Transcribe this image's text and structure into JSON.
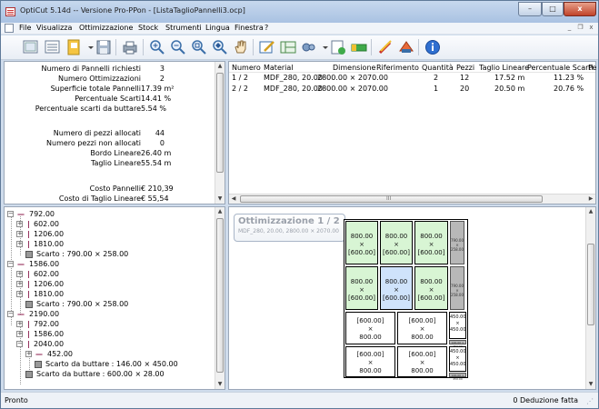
{
  "window": {
    "title": "OptiCut 5.14d -- Versione Pro-PPon - [ListaTaglioPannelli3.ocp]",
    "minimize_glyph": "–",
    "maximize_glyph": "□",
    "close_glyph": "x",
    "mdi_minimize_glyph": "_",
    "mdi_restore_glyph": "❐",
    "mdi_close_glyph": "x"
  },
  "menu": [
    "File",
    "Visualizza",
    "Ottimizzazione",
    "Stock",
    "Strumenti",
    "Lingua",
    "Finestra",
    "?"
  ],
  "toolbar": {
    "icons": [
      "table-icon",
      "list-icon",
      "new-document-icon",
      "save-icon",
      "print-icon",
      "zoom-in-icon",
      "zoom-out-icon",
      "zoom-fit-icon",
      "zoom-selection-icon",
      "hand-pan-icon",
      "edit-icon",
      "optimize-icon",
      "settings-icon",
      "export-icon",
      "database-icon",
      "pencil-icon",
      "materials-icon",
      "info-icon"
    ]
  },
  "summary": [
    {
      "label": "Numero di Pannelli richiesti",
      "value": "3"
    },
    {
      "label": "Numero Ottimizzazioni",
      "value": "2"
    },
    {
      "label": "Superficie totale Pannelli",
      "value": "17.39 m²"
    },
    {
      "label": "Percentuale Scarti",
      "value": "14.41 %"
    },
    {
      "label": "Percentuale scarti da buttare",
      "value": "5.54 %"
    },
    {
      "label": "",
      "value": ""
    },
    {
      "label": "Numero di pezzi allocati",
      "value": "44"
    },
    {
      "label": "Numero pezzi non allocati",
      "value": "0"
    },
    {
      "label": "Bordo Lineare",
      "value": "26.40 m"
    },
    {
      "label": "Taglio Lineare",
      "value": "55.54 m"
    },
    {
      "label": "",
      "value": ""
    },
    {
      "label": "Costo Pannelli",
      "value": "€ 210,39"
    },
    {
      "label": "Costo di Taglio Lineare",
      "value": "€ 55,54"
    }
  ],
  "grid": {
    "columns": [
      "Numero",
      "Material",
      "Dimensione",
      "Riferimento",
      "Quantità",
      "Pezzi",
      "Taglio Lineare",
      "Percentuale Scarti",
      "Pe"
    ],
    "rows": [
      {
        "numero": "1 / 2",
        "material": "MDF_280, 20.00",
        "dimensione": "2800.00 × 2070.00",
        "riferimento": "",
        "quantita": "2",
        "pezzi": "12",
        "taglio": "17.52 m",
        "scarti": "11.23 %"
      },
      {
        "numero": "2 / 2",
        "material": "MDF_280, 20.00",
        "dimensione": "2800.00 × 2070.00",
        "riferimento": "",
        "quantita": "1",
        "pezzi": "20",
        "taglio": "20.50 m",
        "scarti": "20.76 %"
      }
    ],
    "hscroll_mark": "III"
  },
  "tree": {
    "nodes": [
      {
        "label": "792.00",
        "level": 0,
        "kind": "strip"
      },
      {
        "label": "602.00",
        "level": 1,
        "kind": "cut"
      },
      {
        "label": "1206.00",
        "level": 1,
        "kind": "cut"
      },
      {
        "label": "1810.00",
        "level": 1,
        "kind": "cut"
      },
      {
        "label": "Scarto : 790.00 × 258.00",
        "level": 1,
        "kind": "scrap"
      },
      {
        "label": "1586.00",
        "level": 0,
        "kind": "strip"
      },
      {
        "label": "602.00",
        "level": 1,
        "kind": "cut"
      },
      {
        "label": "1206.00",
        "level": 1,
        "kind": "cut"
      },
      {
        "label": "1810.00",
        "level": 1,
        "kind": "cut"
      },
      {
        "label": "Scarto : 790.00 × 258.00",
        "level": 1,
        "kind": "scrap"
      },
      {
        "label": "2190.00",
        "level": 0,
        "kind": "strip"
      },
      {
        "label": "792.00",
        "level": 1,
        "kind": "cut"
      },
      {
        "label": "1586.00",
        "level": 1,
        "kind": "cut"
      },
      {
        "label": "2040.00",
        "level": 1,
        "kind": "cut"
      },
      {
        "label": "452.00",
        "level": 2,
        "kind": "strip"
      },
      {
        "label": "Scarto da buttare : 146.00 × 450.00",
        "level": 2,
        "kind": "scrap"
      },
      {
        "label": "Scarto da buttare : 600.00 × 28.00",
        "level": 1,
        "kind": "scrap"
      }
    ],
    "expander": "+",
    "collapser": "−"
  },
  "layout": {
    "title": "Ottimizzazione 1 / 2",
    "subtitle": "MDF_280, 20.00, 2800.00 × 2070.00",
    "piece_800": "800.00",
    "piece_600": "[600.00]",
    "times": "×",
    "piece_450": "450.00",
    "scrap_text": "790.00 × 258.00",
    "scrap_bottom": "146.00 × 450.00"
  },
  "status": {
    "left": "Pronto",
    "right": "0 Deduzione fatta"
  },
  "colors": {
    "title_gradient_top": "#c7d8ee",
    "piece_green": "#d8f5d4",
    "piece_blue": "#cfe3fb",
    "tree_glyph": "#8b1a4a"
  }
}
